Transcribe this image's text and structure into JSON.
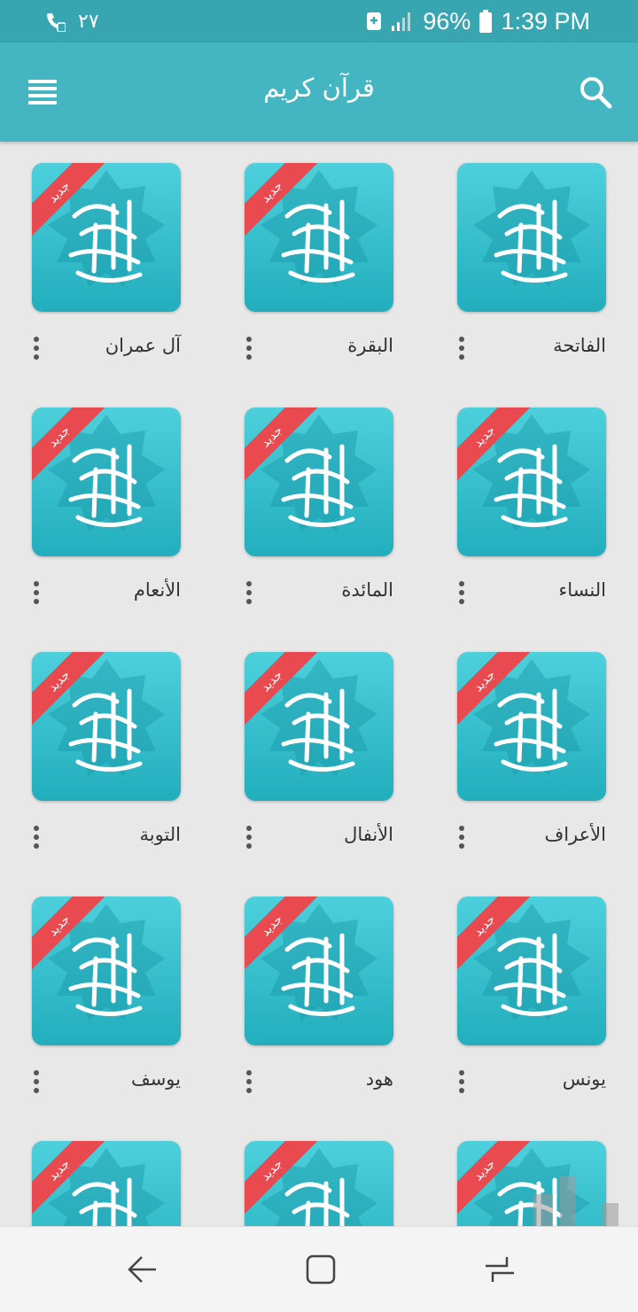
{
  "status_bar": {
    "left_text": "۲۷",
    "battery_percent": "96%",
    "time": "1:39 PM"
  },
  "app_bar": {
    "title": "قرآن کریم",
    "menu_icon": "hamburger-menu-icon",
    "search_icon": "search-icon"
  },
  "badge_label": "جدید",
  "colors": {
    "status_bar": "#37a6b0",
    "app_bar": "#44b6c2",
    "tile": "#2fbfcf",
    "badge": "#e84a4f"
  },
  "surahs": [
    {
      "name": "الفاتحة",
      "badge": false
    },
    {
      "name": "البقرة",
      "badge": true
    },
    {
      "name": "آل عمران",
      "badge": true
    },
    {
      "name": "النساء",
      "badge": true
    },
    {
      "name": "المائدة",
      "badge": true
    },
    {
      "name": "الأنعام",
      "badge": true
    },
    {
      "name": "الأعراف",
      "badge": true
    },
    {
      "name": "الأنفال",
      "badge": true
    },
    {
      "name": "التوبة",
      "badge": true
    },
    {
      "name": "يونس",
      "badge": true
    },
    {
      "name": "هود",
      "badge": true
    },
    {
      "name": "يوسف",
      "badge": true
    },
    {
      "name": "",
      "badge": true
    },
    {
      "name": "",
      "badge": true
    },
    {
      "name": "",
      "badge": true
    }
  ],
  "nav_bar": {
    "back_icon": "back-icon",
    "home_icon": "home-icon",
    "recents_icon": "recents-icon"
  }
}
